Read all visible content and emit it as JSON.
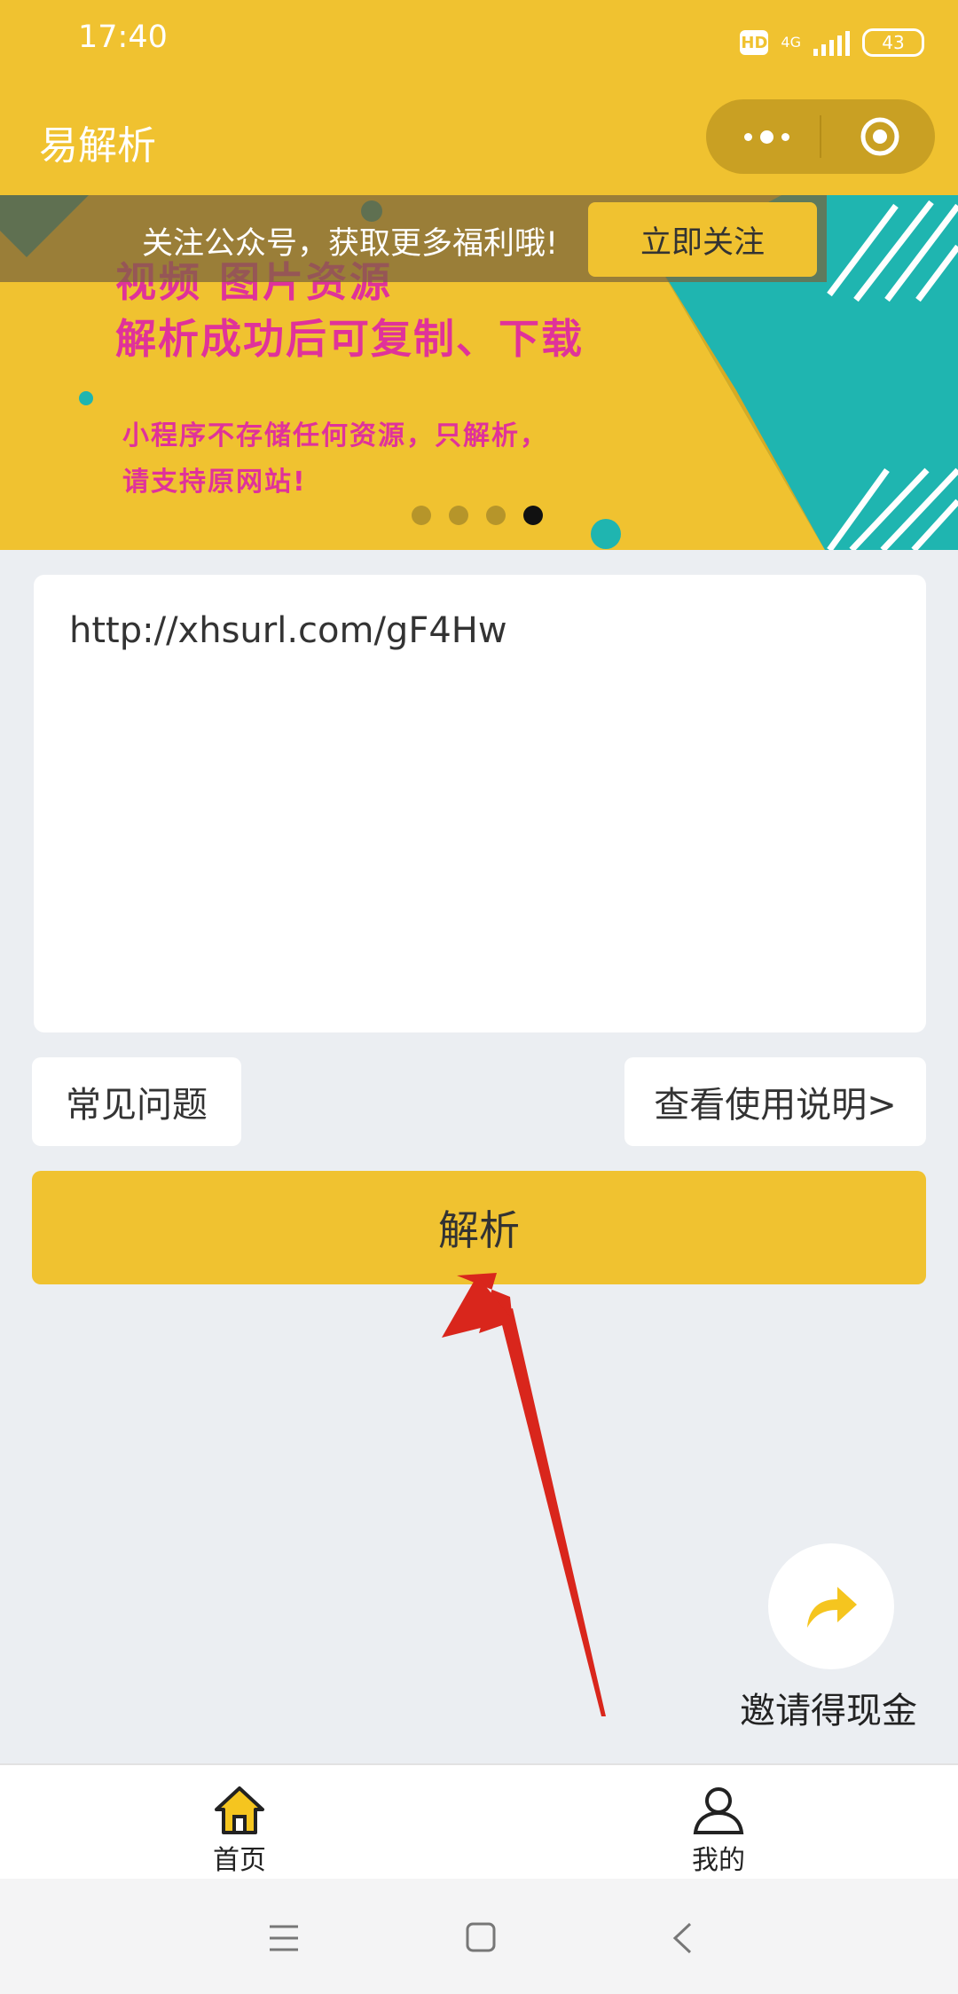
{
  "status_bar": {
    "time": "17:40",
    "hd": "HD",
    "network": "4G",
    "battery": "43"
  },
  "header": {
    "title": "易解析"
  },
  "banner": {
    "follow_text": "关注公众号，获取更多福利哦!",
    "follow_button": "立即关注",
    "line1": "视频 图片资源",
    "line2": "解析成功后可复制、下载",
    "line3": "小程序不存储任何资源，只解析，",
    "line4": "请支持原网站!",
    "active_slide_index": 3,
    "slide_count": 4
  },
  "input": {
    "value": "http://xhsurl.com/gF4Hw"
  },
  "buttons": {
    "faq": "常见问题",
    "guide": "查看使用说明>",
    "parse": "解析"
  },
  "invite": {
    "label": "邀请得现金"
  },
  "tabbar": {
    "items": [
      {
        "label": "首页",
        "active": true
      },
      {
        "label": "我的",
        "active": false
      }
    ]
  },
  "colors": {
    "brand": "#f0c230",
    "teal": "#1fb5b0",
    "magenta": "#e0329a",
    "arrow": "#d9261c"
  }
}
